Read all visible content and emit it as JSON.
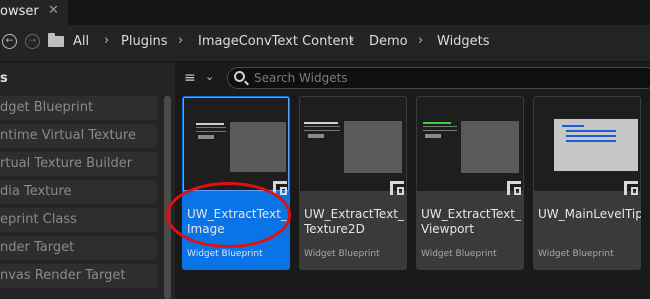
{
  "window": {
    "tab_title": "owser",
    "tab_close": "✕"
  },
  "navigation": {
    "back_label": "←",
    "forward_label": "→",
    "breadcrumbs": [
      "All",
      "Plugins",
      "ImageConvText Content",
      "Demo",
      "Widgets"
    ],
    "separator": "›"
  },
  "filters_panel": {
    "header": "s",
    "items": [
      {
        "label": "dget Blueprint"
      },
      {
        "label": "ntime Virtual Texture"
      },
      {
        "label": "rtual Texture Builder"
      },
      {
        "label": "dia Texture"
      },
      {
        "label": "eprint Class"
      },
      {
        "label": "nder Target"
      },
      {
        "label": "nvas Render Target"
      }
    ]
  },
  "toolbar": {
    "filter_icon": "≡",
    "filter_caret": "⌄",
    "search_placeholder": "Search Widgets"
  },
  "assets": [
    {
      "name": "UW_ExtractText_ Image",
      "type": "Widget Blueprint",
      "selected": true
    },
    {
      "name": "UW_ExtractText_ Texture2D",
      "type": "Widget Blueprint",
      "selected": false
    },
    {
      "name": "UW_ExtractText_ Viewport",
      "type": "Widget Blueprint",
      "selected": false
    },
    {
      "name": "UW_MainLevelTips",
      "type": "Widget Blueprint",
      "selected": false
    }
  ],
  "colors": {
    "selection": "#0a73e6",
    "highlight_ring": "#e01010",
    "panel": "#242424",
    "background": "#1a1a1a"
  }
}
